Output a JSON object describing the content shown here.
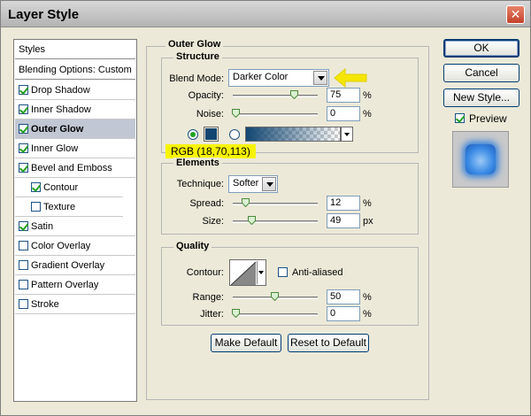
{
  "window": {
    "title": "Layer Style",
    "close_label": "✕"
  },
  "styles": {
    "header": "Styles",
    "blending": "Blending Options: Custom",
    "items": [
      {
        "label": "Drop Shadow",
        "checked": true
      },
      {
        "label": "Inner Shadow",
        "checked": true
      },
      {
        "label": "Outer Glow",
        "checked": true,
        "selected": true
      },
      {
        "label": "Inner Glow",
        "checked": true
      },
      {
        "label": "Bevel and Emboss",
        "checked": true
      },
      {
        "label": "Contour",
        "checked": true,
        "indent": true
      },
      {
        "label": "Texture",
        "checked": false,
        "indent": true
      },
      {
        "label": "Satin",
        "checked": true
      },
      {
        "label": "Color Overlay",
        "checked": false
      },
      {
        "label": "Gradient Overlay",
        "checked": false
      },
      {
        "label": "Pattern Overlay",
        "checked": false
      },
      {
        "label": "Stroke",
        "checked": false
      }
    ]
  },
  "outer_glow": {
    "title": "Outer Glow",
    "structure": {
      "title": "Structure",
      "blend_mode_label": "Blend Mode:",
      "blend_mode_value": "Darker Color",
      "opacity_label": "Opacity:",
      "opacity_value": "75",
      "opacity_level": 0.75,
      "noise_label": "Noise:",
      "noise_value": "0",
      "noise_level": 0,
      "unit": "%",
      "glow_color": "#124671",
      "rgb_note": "RGB (18,70,113)"
    },
    "elements": {
      "title": "Elements",
      "technique_label": "Technique:",
      "technique_value": "Softer",
      "spread_label": "Spread:",
      "spread_value": "12",
      "spread_level": 0.12,
      "spread_unit": "%",
      "size_label": "Size:",
      "size_value": "49",
      "size_level": 0.2,
      "size_unit": "px"
    },
    "quality": {
      "title": "Quality",
      "contour_label": "Contour:",
      "anti_aliased_label": "Anti-aliased",
      "range_label": "Range:",
      "range_value": "50",
      "range_level": 0.5,
      "jitter_label": "Jitter:",
      "jitter_value": "0",
      "jitter_level": 0,
      "unit": "%"
    },
    "make_default": "Make Default",
    "reset_default": "Reset to Default"
  },
  "buttons": {
    "ok": "OK",
    "cancel": "Cancel",
    "new_style": "New Style...",
    "preview": "Preview"
  },
  "colors": {
    "accent_highlight": "#f7f400",
    "arrow": "#f5e600",
    "preview_glow": "#2c7ee0"
  }
}
